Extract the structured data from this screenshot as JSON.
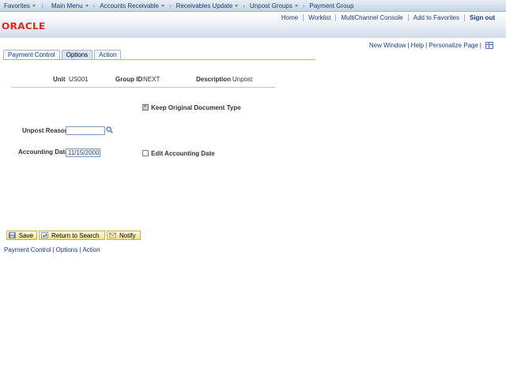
{
  "topnav": {
    "favorites": "Favorites",
    "main_menu": "Main Menu",
    "breadcrumbs": [
      "Accounts Receivable",
      "Receivables Update",
      "Unpost Groups",
      "Payment Group"
    ]
  },
  "header": {
    "logo": "ORACLE",
    "universal_links": [
      "Home",
      "Worklist",
      "MultiChannel Console",
      "Add to Favorites"
    ],
    "sign_out": "Sign out"
  },
  "pagebar": {
    "new_window": "New Window",
    "help": "Help",
    "personalize": "Personalize Page"
  },
  "tabs": [
    {
      "label": "Payment Control",
      "active": false
    },
    {
      "label": "Options",
      "active": true
    },
    {
      "label": "Action",
      "active": false
    }
  ],
  "keys": {
    "unit_label": "Unit",
    "unit_value": "US001",
    "group_label": "Group ID",
    "group_value": "NEXT",
    "desc_label": "Description",
    "desc_value": "Unpost"
  },
  "form": {
    "keep_original_label": "Keep Original Document Type",
    "keep_original_checked": true,
    "unpost_reason_label": "Unpost Reason",
    "unpost_reason_value": "",
    "accounting_date_label": "Accounting Date",
    "accounting_date_value": "11/15/2000",
    "edit_accounting_label": "Edit Accounting Date",
    "edit_accounting_checked": false
  },
  "toolbar": {
    "save": "Save",
    "return_to_search": "Return to Search",
    "notify": "Notify"
  },
  "footer_links": [
    "Payment Control",
    "Options",
    "Action"
  ],
  "colors": {
    "brand_red": "#e0251b",
    "link_blue": "#1a3b84",
    "button_yellow": "#f2df8e"
  }
}
